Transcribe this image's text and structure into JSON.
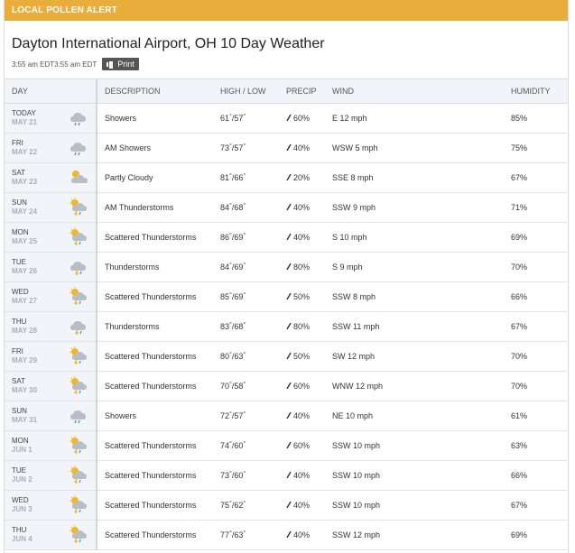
{
  "alert": {
    "label": "LOCAL POLLEN ALERT"
  },
  "header": {
    "title": "Dayton International Airport, OH 10 Day Weather",
    "time": "3:55 am EDT3:55 am EDT",
    "print_label": "Print"
  },
  "table": {
    "headers": {
      "day": "DAY",
      "description": "DESCRIPTION",
      "highlow": "HIGH / LOW",
      "precip": "PRECIP",
      "wind": "WIND",
      "humidity": "HUMIDITY"
    },
    "rows": [
      {
        "day": "TODAY",
        "date": "MAY 21",
        "icon": "showers-icon",
        "desc": "Showers",
        "high": "61",
        "low": "57",
        "precip": "60%",
        "wind": "E 12 mph",
        "humidity": "85%"
      },
      {
        "day": "FRI",
        "date": "MAY 22",
        "icon": "showers-icon",
        "desc": "AM Showers",
        "high": "73",
        "low": "57",
        "precip": "40%",
        "wind": "WSW 5 mph",
        "humidity": "75%"
      },
      {
        "day": "SAT",
        "date": "MAY 23",
        "icon": "partly-cloudy-icon",
        "desc": "Partly Cloudy",
        "high": "81",
        "low": "66",
        "precip": "20%",
        "wind": "SSE 8 mph",
        "humidity": "67%"
      },
      {
        "day": "SUN",
        "date": "MAY 24",
        "icon": "sun-thunderstorm-icon",
        "desc": "AM Thunderstorms",
        "high": "84",
        "low": "68",
        "precip": "40%",
        "wind": "SSW 9 mph",
        "humidity": "71%"
      },
      {
        "day": "MON",
        "date": "MAY 25",
        "icon": "sun-thunderstorm-icon",
        "desc": "Scattered Thunderstorms",
        "high": "86",
        "low": "69",
        "precip": "40%",
        "wind": "S 10 mph",
        "humidity": "69%"
      },
      {
        "day": "TUE",
        "date": "MAY 26",
        "icon": "thunderstorm-icon",
        "desc": "Thunderstorms",
        "high": "84",
        "low": "69",
        "precip": "80%",
        "wind": "S 9 mph",
        "humidity": "70%"
      },
      {
        "day": "WED",
        "date": "MAY 27",
        "icon": "sun-thunderstorm-icon",
        "desc": "Scattered Thunderstorms",
        "high": "85",
        "low": "69",
        "precip": "50%",
        "wind": "SSW 8 mph",
        "humidity": "66%"
      },
      {
        "day": "THU",
        "date": "MAY 28",
        "icon": "thunderstorm-icon",
        "desc": "Thunderstorms",
        "high": "83",
        "low": "68",
        "precip": "80%",
        "wind": "SSW 11 mph",
        "humidity": "67%"
      },
      {
        "day": "FRI",
        "date": "MAY 29",
        "icon": "sun-thunderstorm-icon",
        "desc": "Scattered Thunderstorms",
        "high": "80",
        "low": "63",
        "precip": "50%",
        "wind": "SW 12 mph",
        "humidity": "70%"
      },
      {
        "day": "SAT",
        "date": "MAY 30",
        "icon": "sun-thunderstorm-icon",
        "desc": "Scattered Thunderstorms",
        "high": "70",
        "low": "58",
        "precip": "60%",
        "wind": "WNW 12 mph",
        "humidity": "70%"
      },
      {
        "day": "SUN",
        "date": "MAY 31",
        "icon": "showers-icon",
        "desc": "Showers",
        "high": "72",
        "low": "57",
        "precip": "40%",
        "wind": "NE 10 mph",
        "humidity": "61%"
      },
      {
        "day": "MON",
        "date": "JUN 1",
        "icon": "sun-thunderstorm-icon",
        "desc": "Scattered Thunderstorms",
        "high": "74",
        "low": "60",
        "precip": "60%",
        "wind": "SSW 10 mph",
        "humidity": "63%"
      },
      {
        "day": "TUE",
        "date": "JUN 2",
        "icon": "sun-thunderstorm-icon",
        "desc": "Scattered Thunderstorms",
        "high": "73",
        "low": "60",
        "precip": "40%",
        "wind": "SSW 10 mph",
        "humidity": "66%"
      },
      {
        "day": "WED",
        "date": "JUN 3",
        "icon": "sun-thunderstorm-icon",
        "desc": "Scattered Thunderstorms",
        "high": "75",
        "low": "62",
        "precip": "40%",
        "wind": "SSW 10 mph",
        "humidity": "67%"
      },
      {
        "day": "THU",
        "date": "JUN 4",
        "icon": "sun-thunderstorm-icon",
        "desc": "Scattered Thunderstorms",
        "high": "77",
        "low": "63",
        "precip": "40%",
        "wind": "SSW 12 mph",
        "humidity": "69%"
      }
    ]
  },
  "colors": {
    "alert_bg": "#e8ad3a",
    "cloud": "#b9bec5",
    "sun": "#f3b81d",
    "rain": "#4a90c8",
    "bolt": "#f0b21a"
  }
}
